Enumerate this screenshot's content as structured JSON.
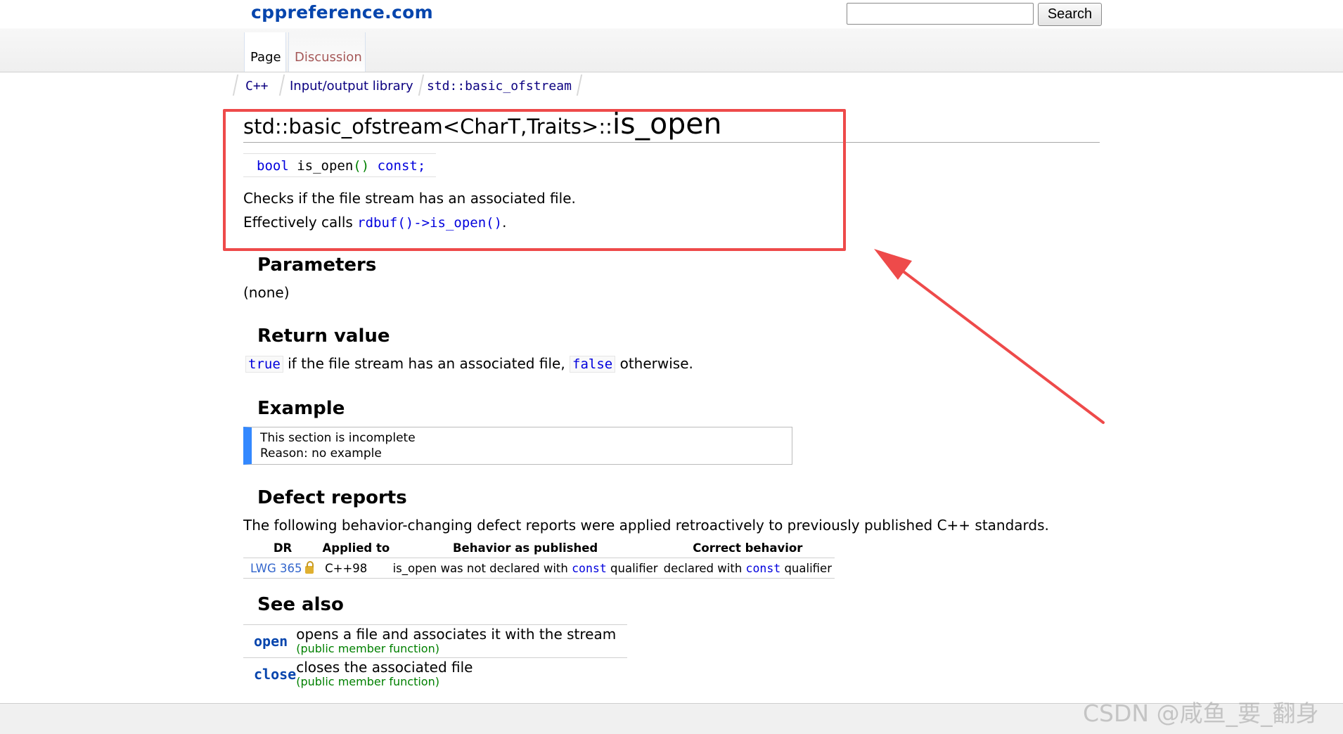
{
  "header": {
    "site_name": "cppreference.com",
    "search_placeholder": "",
    "search_button": "Search",
    "tabs": [
      {
        "label": "Page"
      },
      {
        "label": "Discussion"
      }
    ]
  },
  "breadcrumb": [
    "C++",
    "Input/output library",
    "std::basic_ofstream"
  ],
  "title": {
    "prefix": "std::basic_ofstream<CharT,Traits>::",
    "name": "is_open"
  },
  "declaration": {
    "type": "bool",
    "name": "is_open",
    "parens": "()",
    "qualifier": "const;"
  },
  "description": {
    "line1": "Checks if the file stream has an associated file.",
    "line2_prefix": "Effectively calls ",
    "line2_code": "rdbuf()->is_open()",
    "line2_suffix": "."
  },
  "parameters": {
    "heading": "Parameters",
    "text": "(none)"
  },
  "return_value": {
    "heading": "Return value",
    "true_code": "true",
    "middle": " if the file stream has an associated file, ",
    "false_code": "false",
    "end": " otherwise."
  },
  "example": {
    "heading": "Example",
    "notice_line1": "This section is incomplete",
    "notice_line2": "Reason: no example"
  },
  "defect_reports": {
    "heading": "Defect reports",
    "intro": "The following behavior-changing defect reports were applied retroactively to previously published C++ standards.",
    "columns": [
      "DR",
      "Applied to",
      "Behavior as published",
      "Correct behavior"
    ],
    "rows": [
      {
        "dr": "LWG 365",
        "applied_to": "C++98",
        "published_pre": "is_open was not declared with ",
        "published_code": "const",
        "published_post": " qualifier",
        "correct_pre": "declared with ",
        "correct_code": "const",
        "correct_post": " qualifier"
      }
    ]
  },
  "see_also": {
    "heading": "See also",
    "items": [
      {
        "name": "open",
        "desc": "opens a file and associates it with the stream",
        "kind": "(public member function)"
      },
      {
        "name": "close",
        "desc": "closes the associated file",
        "kind": "(public member function)"
      }
    ]
  },
  "watermark": "CSDN @咸鱼_要_翻身",
  "colors": {
    "link": "#0645ad",
    "highlight_border": "#ee4a4a",
    "arrow": "#ee4a4a",
    "notice_bar": "#3388ff",
    "keyword": "#0000dd",
    "subtitle_green": "#008000"
  }
}
